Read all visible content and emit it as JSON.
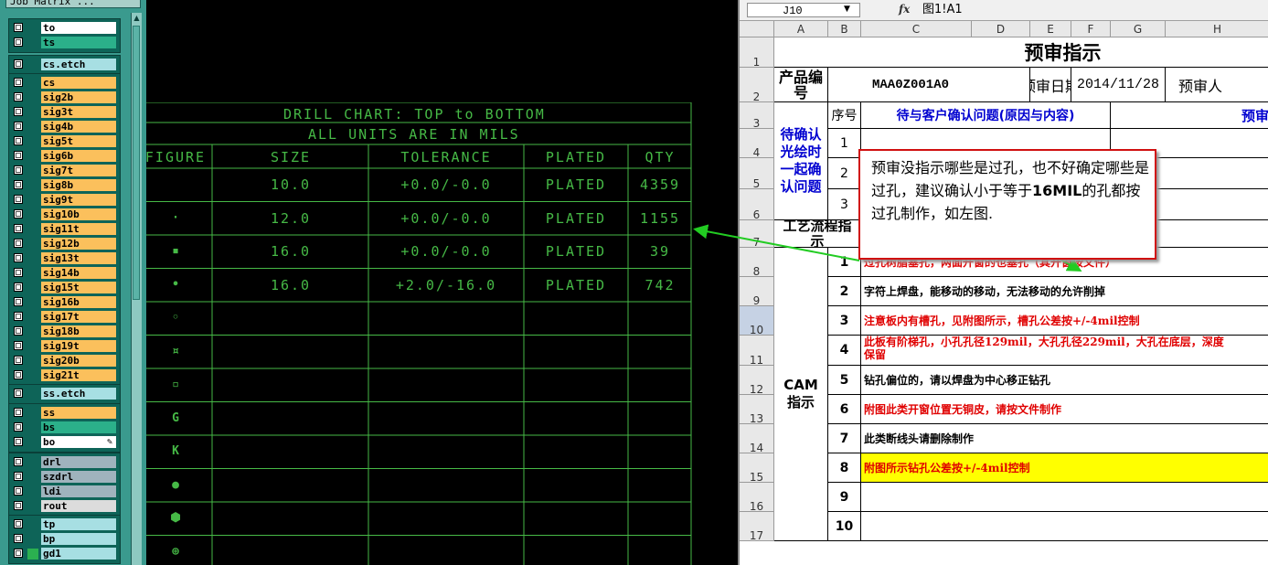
{
  "layer_panel": {
    "title": "Job Matrix ...",
    "groups": [
      {
        "rows": [
          {
            "name": "to",
            "color": "#ffffff"
          },
          {
            "name": "ts",
            "color": "#2bb08a"
          }
        ]
      },
      {
        "rows": [
          {
            "name": "cs.etch",
            "color": "#a7dfe3"
          }
        ]
      },
      {
        "rows": [
          {
            "name": "cs",
            "color": "#fbc05c"
          },
          {
            "name": "sig2b",
            "color": "#fbc05c"
          },
          {
            "name": "sig3t",
            "color": "#fbc05c"
          },
          {
            "name": "sig4b",
            "color": "#fbc05c"
          },
          {
            "name": "sig5t",
            "color": "#fbc05c"
          },
          {
            "name": "sig6b",
            "color": "#fbc05c"
          },
          {
            "name": "sig7t",
            "color": "#fbc05c"
          },
          {
            "name": "sig8b",
            "color": "#fbc05c"
          },
          {
            "name": "sig9t",
            "color": "#fbc05c"
          },
          {
            "name": "sig10b",
            "color": "#fbc05c"
          },
          {
            "name": "sig11t",
            "color": "#fbc05c"
          },
          {
            "name": "sig12b",
            "color": "#fbc05c"
          },
          {
            "name": "sig13t",
            "color": "#fbc05c"
          },
          {
            "name": "sig14b",
            "color": "#fbc05c"
          },
          {
            "name": "sig15t",
            "color": "#fbc05c"
          },
          {
            "name": "sig16b",
            "color": "#fbc05c"
          },
          {
            "name": "sig17t",
            "color": "#fbc05c"
          },
          {
            "name": "sig18b",
            "color": "#fbc05c"
          },
          {
            "name": "sig19t",
            "color": "#fbc05c"
          },
          {
            "name": "sig20b",
            "color": "#fbc05c"
          },
          {
            "name": "sig21t",
            "color": "#fbc05c"
          }
        ]
      },
      {
        "rows": [
          {
            "name": "ss.etch",
            "color": "#a7dfe3"
          }
        ]
      },
      {
        "rows": [
          {
            "name": "ss",
            "color": "#fbc05c"
          },
          {
            "name": "bs",
            "color": "#2bb08a"
          },
          {
            "name": "bo",
            "color": "#ffffff"
          }
        ]
      },
      {
        "rows": [
          {
            "name": "drl",
            "color": "#9fb3bd"
          },
          {
            "name": "szdrl",
            "color": "#9fb3bd"
          },
          {
            "name": "ldi",
            "color": "#9fb3bd"
          },
          {
            "name": "rout",
            "color": "#dcdcdc"
          }
        ]
      },
      {
        "rows": [
          {
            "name": "tp",
            "color": "#a7dfe3"
          },
          {
            "name": "bp",
            "color": "#a7dfe3"
          },
          {
            "name": "gd1",
            "color": "#a7dfe3"
          }
        ]
      }
    ]
  },
  "drill_chart": {
    "title": "DRILL CHART: TOP to BOTTOM",
    "units": "ALL UNITS ARE IN MILS",
    "headers": [
      "FIGURE",
      "SIZE",
      "TOLERANCE",
      "PLATED",
      "QTY"
    ],
    "rows": [
      {
        "figure": "",
        "size": "10.0",
        "tolerance": "+0.0/-0.0",
        "plated": "PLATED",
        "qty": "4359"
      },
      {
        "figure": "·",
        "size": "12.0",
        "tolerance": "+0.0/-0.0",
        "plated": "PLATED",
        "qty": "1155"
      },
      {
        "figure": "▪",
        "size": "16.0",
        "tolerance": "+0.0/-0.0",
        "plated": "PLATED",
        "qty": "39"
      },
      {
        "figure": "•",
        "size": "16.0",
        "tolerance": "+2.0/-16.0",
        "plated": "PLATED",
        "qty": "742"
      },
      {
        "figure": "◦",
        "size": "",
        "tolerance": "",
        "plated": "",
        "qty": ""
      },
      {
        "figure": "¤",
        "size": "",
        "tolerance": "",
        "plated": "",
        "qty": ""
      },
      {
        "figure": "▫",
        "size": "",
        "tolerance": "",
        "plated": "",
        "qty": ""
      },
      {
        "figure": "G",
        "size": "",
        "tolerance": "",
        "plated": "",
        "qty": ""
      },
      {
        "figure": "K",
        "size": "",
        "tolerance": "",
        "plated": "",
        "qty": ""
      },
      {
        "figure": "●",
        "size": "",
        "tolerance": "",
        "plated": "",
        "qty": ""
      },
      {
        "figure": "⬢",
        "size": "",
        "tolerance": "",
        "plated": "",
        "qty": ""
      },
      {
        "figure": "⊕",
        "size": "",
        "tolerance": "",
        "plated": "",
        "qty": ""
      }
    ],
    "color": "#46b946"
  },
  "excel": {
    "namebox": "J10",
    "fx": "fx",
    "formula": "图1!A1",
    "columns": [
      "A",
      "B",
      "C",
      "D",
      "E",
      "F",
      "G",
      "H"
    ],
    "rows": [
      "1",
      "2",
      "3",
      "4",
      "5",
      "6",
      "7",
      "8",
      "9",
      "10",
      "11",
      "12",
      "13",
      "14",
      "15",
      "16",
      "17"
    ],
    "selected_row": "10",
    "title": "预审指示",
    "product_label": "产品编号",
    "product_no": "MAA0Z001A0",
    "review_date_label": "预审日期",
    "review_date": "2014/11/28",
    "reviewer_label": "预审人",
    "seq_label": "序号",
    "confirm_label": "待确认光绘时一起确认问题",
    "issue_header": "待与客户确认问题(原因与内容)",
    "cut_header": "预审",
    "confirm_nums": [
      "1",
      "2",
      "3"
    ],
    "process_label": "工艺流程指示",
    "cam_label": "CAM指示",
    "cam_items": [
      {
        "n": "1",
        "text": "过孔树脂塞孔，两面开窗的也塞孔（其开窗按文件）",
        "style": "red"
      },
      {
        "n": "2",
        "text": "字符上焊盘，能移动的移动，无法移动的允许削掉",
        "style": "black"
      },
      {
        "n": "3",
        "text": "注意板内有槽孔，见附图所示，槽孔公差按+/-4mil控制",
        "style": "red"
      },
      {
        "n": "4",
        "text": "此板有阶梯孔，小孔孔径129mil，大孔孔径229mil，大孔在底层，深度",
        "text2": "保留",
        "style": "red"
      },
      {
        "n": "5",
        "text": "钻孔偏位的，请以焊盘为中心移正钻孔",
        "style": "black"
      },
      {
        "n": "6",
        "text": "附图此类开窗位置无铜皮，请按文件制作",
        "style": "red"
      },
      {
        "n": "7",
        "text": "此类断线头请删除制作",
        "style": "black"
      },
      {
        "n": "8",
        "text": "附图所示钻孔公差按+/-4mil控制",
        "style": "red-yellow"
      },
      {
        "n": "9",
        "text": "",
        "style": "black"
      },
      {
        "n": "10",
        "text": "",
        "style": "black"
      }
    ]
  },
  "callout": {
    "text_before": "预审没指示哪些是过孔，也不好确定哪些是过孔，建议确认小于等于",
    "text_bold": "16MIL",
    "text_after": "的孔都按过孔制作，如左图."
  },
  "colors": {
    "panel_bg": "#3a9a8e",
    "drill_green": "#46b946",
    "callout_border": "#d01010",
    "arrow_green": "#22cc22",
    "highlight_yellow": "#ffff00",
    "excel_red": "#e00000",
    "excel_blue": "#0000d0"
  }
}
